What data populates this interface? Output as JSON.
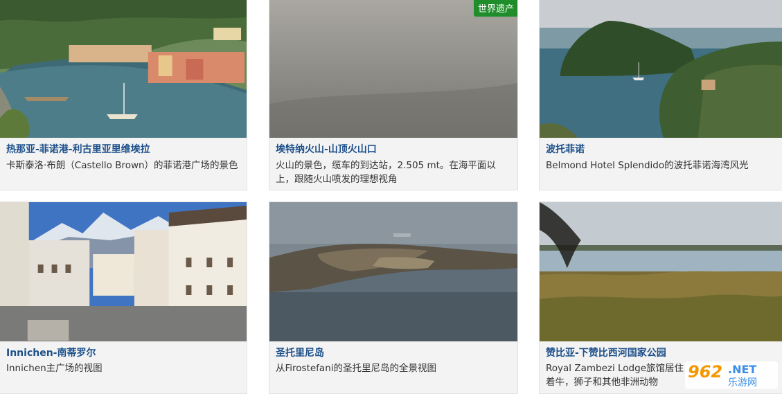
{
  "cards": [
    {
      "title": "热那亚-菲诺港-利古里亚里维埃拉",
      "desc": "卡斯泰洛·布朗（Castello Brown）的菲诺港广场的景色"
    },
    {
      "title": "埃特纳火山-山顶火山口",
      "desc": "火山的景色，缆车的到达站，2.505 mt。在海平面以上，跟随火山喷发的理想视角",
      "badge": "世界遗产"
    },
    {
      "title": "波托菲诺",
      "desc": "Belmond Hotel Splendido的波托菲诺海湾风光"
    },
    {
      "title": "Innichen-南蒂罗尔",
      "desc": "Innichen主广场的视图"
    },
    {
      "title": "圣托里尼岛",
      "desc": "从Firostefani的圣托里尼岛的全景视图"
    },
    {
      "title": "赞比亚-下赞比西河国家公园",
      "desc": "Royal Zambezi Lodge旅馆居住着牛，狮子和其他非洲动物"
    }
  ],
  "watermark": {
    "number": "962",
    "suffix": ".NET",
    "name": "乐游网"
  },
  "colors": {
    "title": "#1c4f8a",
    "badge": "#1f8e2a",
    "card_bg": "#f3f3f3"
  }
}
